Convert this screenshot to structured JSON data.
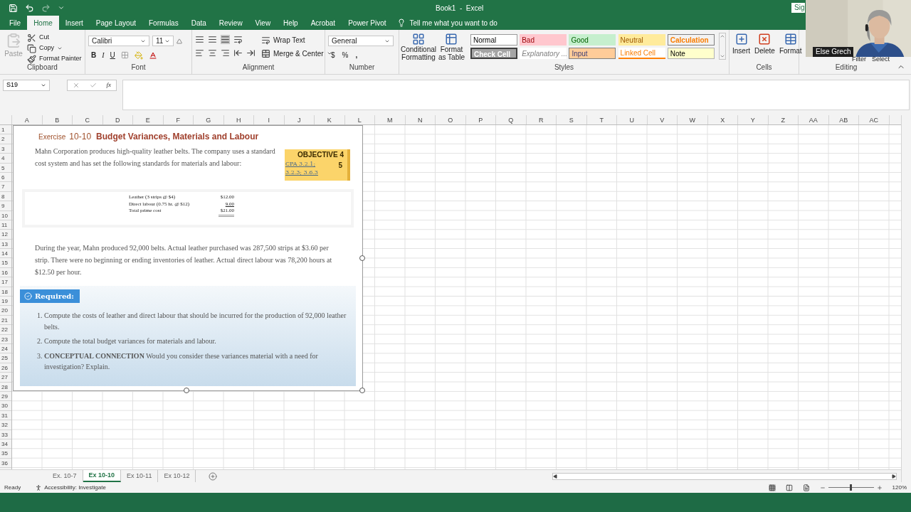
{
  "title_bar": {
    "title": "Book1  -  Excel",
    "sign_in": "Sig"
  },
  "menu_tabs": [
    {
      "label": "File",
      "selected": false
    },
    {
      "label": "Home",
      "selected": true
    },
    {
      "label": "Insert",
      "selected": false
    },
    {
      "label": "Page Layout",
      "selected": false
    },
    {
      "label": "Formulas",
      "selected": false
    },
    {
      "label": "Data",
      "selected": false
    },
    {
      "label": "Review",
      "selected": false
    },
    {
      "label": "View",
      "selected": false
    },
    {
      "label": "Help",
      "selected": false
    },
    {
      "label": "Acrobat",
      "selected": false
    },
    {
      "label": "Power Pivot",
      "selected": false
    }
  ],
  "tell_me": "Tell me what you want to do",
  "ribbon": {
    "clipboard": {
      "paste": "Paste",
      "cut": "Cut",
      "copy": "Copy",
      "format_painter": "Format Painter",
      "label": "Clipboard"
    },
    "font": {
      "name": "Calibri",
      "size": "11",
      "bold": "B",
      "italic": "I",
      "underline": "U",
      "label": "Font"
    },
    "alignment": {
      "wrap": "Wrap Text",
      "merge": "Merge & Center",
      "label": "Alignment"
    },
    "number": {
      "format": "General",
      "currency": "$",
      "percent": "%",
      "comma": ",",
      "label": "Number"
    },
    "styles": {
      "conditional": "Conditional Formatting",
      "format_table": "Format as Table",
      "label": "Styles",
      "cells": [
        {
          "label": "Normal",
          "kind": "normal"
        },
        {
          "label": "Bad",
          "kind": "bad"
        },
        {
          "label": "Good",
          "kind": "good"
        },
        {
          "label": "Neutral",
          "kind": "neutral"
        },
        {
          "label": "Calculation",
          "kind": "calculation"
        },
        {
          "label": "Check Cell",
          "kind": "check"
        },
        {
          "label": "Explanatory ...",
          "kind": "explanatory"
        },
        {
          "label": "Input",
          "kind": "input"
        },
        {
          "label": "Linked Cell",
          "kind": "linked"
        },
        {
          "label": "Note",
          "kind": "note"
        }
      ]
    },
    "cells": {
      "buttons": [
        "Insert",
        "Delete",
        "Format"
      ],
      "label": "Cells"
    },
    "editing": {
      "buttons": [
        "Filter",
        "Select"
      ],
      "label": "Editing"
    }
  },
  "formula_bar": {
    "name_box": "S19",
    "fx": "fx"
  },
  "columns": [
    "A",
    "B",
    "C",
    "D",
    "E",
    "F",
    "G",
    "H",
    "I",
    "J",
    "K",
    "L",
    "M",
    "N",
    "O",
    "P",
    "Q",
    "R",
    "S",
    "T",
    "U",
    "V",
    "W",
    "X",
    "Y",
    "Z",
    "AA",
    "AB",
    "AC"
  ],
  "rows": [
    "1",
    "2",
    "3",
    "4",
    "5",
    "6",
    "7",
    "8",
    "9",
    "10",
    "11",
    "12",
    "13",
    "14",
    "15",
    "16",
    "17",
    "18",
    "19",
    "20",
    "21",
    "22",
    "23",
    "24",
    "25",
    "26",
    "27",
    "28",
    "29",
    "30",
    "31",
    "32",
    "33",
    "34",
    "35",
    "36"
  ],
  "exercise": {
    "label": "Exercise",
    "number": "10-10",
    "title": "Budget Variances, Materials and Labour",
    "intro": "Mahn Corporation produces high-quality leather belts. The company uses a standard cost system and has set the following standards for materials and labour:",
    "objective": "OBJECTIVE 4",
    "objective_extra": "5",
    "cpa": "CPA 3.2.1; 3.2.3; 3.6.3",
    "standards": [
      {
        "item": "Leather (3 strips @ $4)",
        "amount": "$12.00"
      },
      {
        "item": "Direct labour (0.75 hr. @ $12)",
        "amount": "9.00"
      },
      {
        "item": "Total prime cost",
        "amount": "$21.00"
      }
    ],
    "facts": "During the year, Mahn produced 92,000 belts. Actual leather purchased was 287,500 strips at $3.60 per strip. There were no beginning or ending inventories of leather. Actual direct labour was 78,200 hours at $12.50 per hour.",
    "required": "Required:",
    "items": [
      {
        "number": "1.",
        "text": "Compute the costs of leather and direct labour that should be incurred for the production of 92,000 leather belts."
      },
      {
        "number": "2.",
        "text": "Compute the total budget variances for materials and labour."
      },
      {
        "number": "3.",
        "text": "**CONCEPTUAL CONNECTION** Would you consider these variances material with a need for investigation? Explain."
      }
    ]
  },
  "sheet_tabs": [
    {
      "label": "Ex. 10-7",
      "selected": false
    },
    {
      "label": "Ex 10-10",
      "selected": true
    },
    {
      "label": "Ex 10-11",
      "selected": false
    },
    {
      "label": "Ex 10-12",
      "selected": false
    }
  ],
  "status_bar": {
    "ready": "Ready",
    "accessibility": "Accessibility: Investigate",
    "zoom": "120%",
    "zoom_slider": {
      "level": 0.5
    }
  },
  "webcam": {
    "name": "Else Grech"
  }
}
